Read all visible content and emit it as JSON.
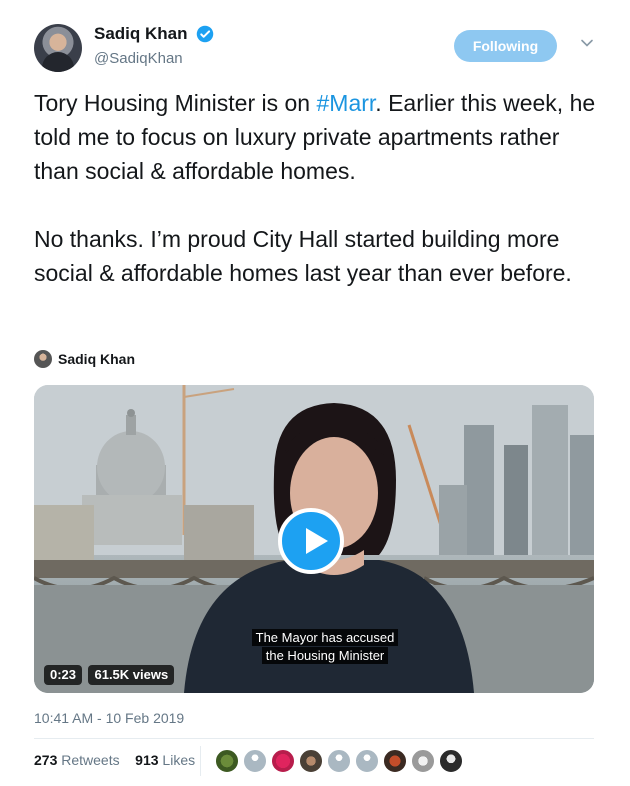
{
  "author": {
    "name": "Sadiq Khan",
    "handle": "@SadiqKhan",
    "verified": true
  },
  "follow_button": {
    "label": "Following"
  },
  "tweet": {
    "paragraph1_pre": "Tory Housing Minister is on ",
    "hashtag": "#Marr",
    "paragraph1_post": ". Earlier this week, he told me to focus on luxury private apartments rather than social & affordable homes.",
    "paragraph2": "No thanks. I’m proud City Hall started building more social & affordable homes last year than ever before."
  },
  "attribution": {
    "name": "Sadiq Khan"
  },
  "video": {
    "caption_line1": "The Mayor has accused",
    "caption_line2": "the Housing Minister",
    "duration": "0:23",
    "views": "61.5K views"
  },
  "timestamp": "10:41 AM - 10 Feb 2019",
  "stats": {
    "retweets_count": "273",
    "retweets_label": "Retweets",
    "likes_count": "913",
    "likes_label": "Likes"
  },
  "colors": {
    "accent": "#1da1f2",
    "hashtag": "#1b95e0",
    "follow_button": "#8ec8f1",
    "muted": "#657786"
  }
}
